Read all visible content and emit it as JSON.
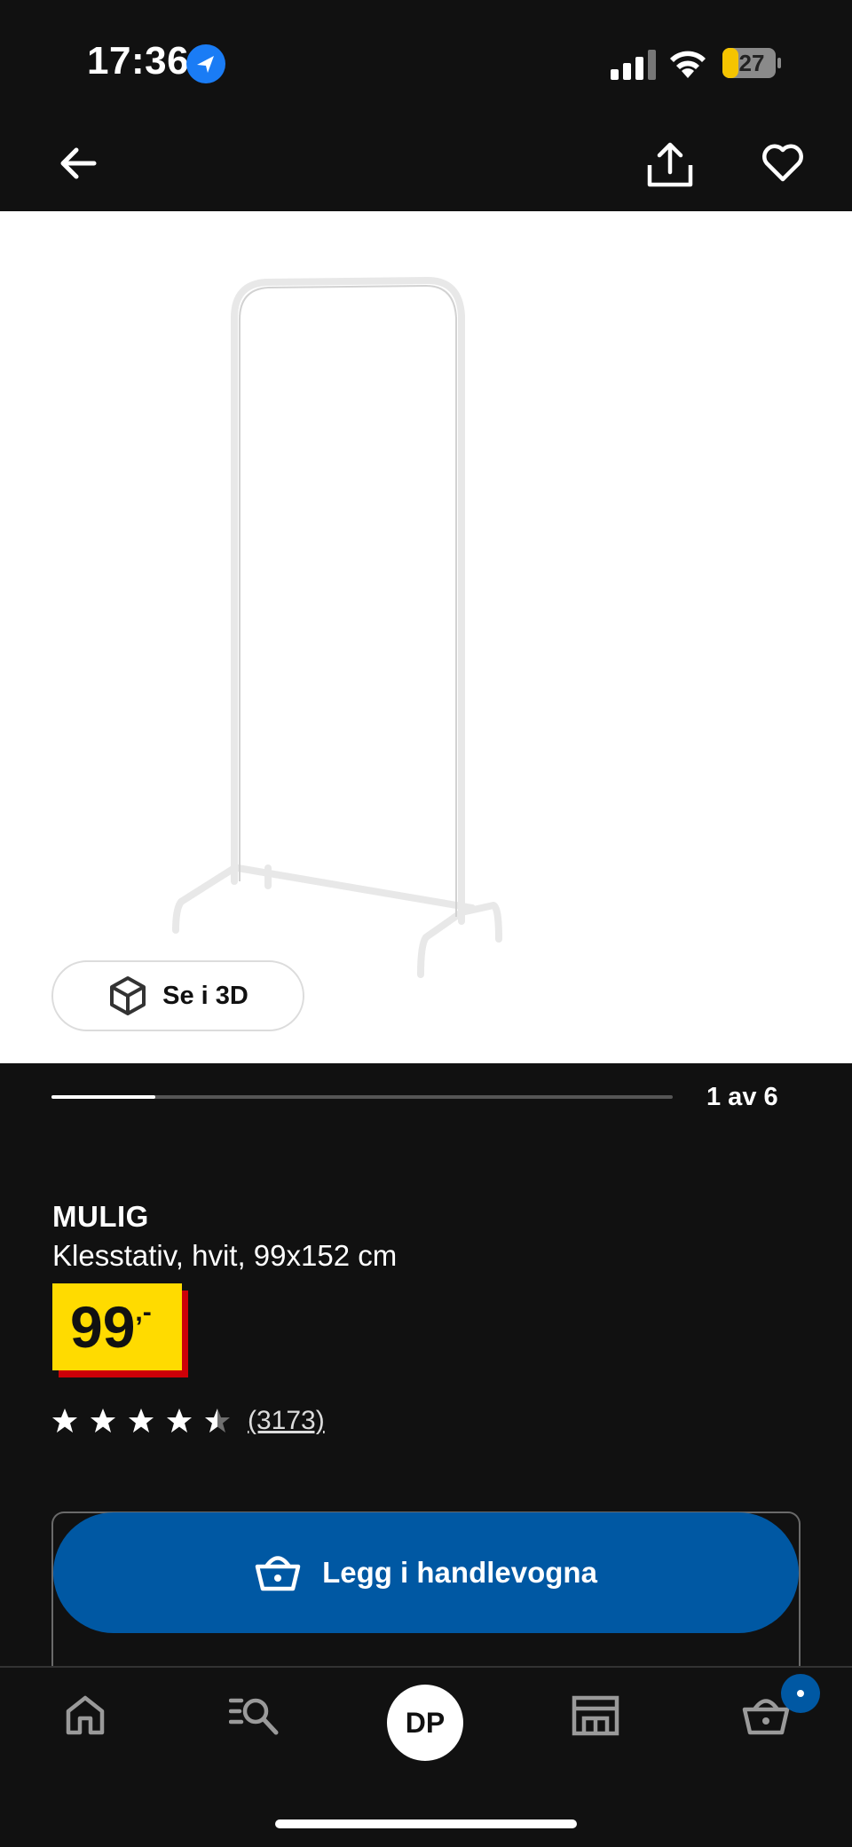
{
  "status_bar": {
    "time": "17:36",
    "battery": "27",
    "icons": [
      "location-arrow-icon",
      "signal-icon",
      "wifi-icon",
      "battery-icon"
    ]
  },
  "top_nav": {
    "icons": [
      "back-arrow-icon",
      "share-icon",
      "heart-icon"
    ]
  },
  "gallery": {
    "view_3d_label": "Se i 3D",
    "counter": "1 av 6",
    "current_image": 1,
    "total_images": 6
  },
  "product": {
    "name": "MULIG",
    "description": "Klesstativ, hvit, 99x152 cm",
    "price": "99",
    "price_suffix": ",-",
    "rating": 4.5,
    "rating_max": 5,
    "review_count": "(3173)"
  },
  "actions": {
    "add_to_cart_label": "Legg i handlevogna"
  },
  "tab_bar": {
    "avatar_initials": "DP",
    "icons": [
      "home-icon",
      "search-list-icon",
      "avatar",
      "store-icon",
      "basket-icon"
    ]
  },
  "colors": {
    "background": "#111111",
    "accent_blue": "#0058a3",
    "price_yellow": "#ffdb00",
    "price_red": "#cc0008"
  }
}
